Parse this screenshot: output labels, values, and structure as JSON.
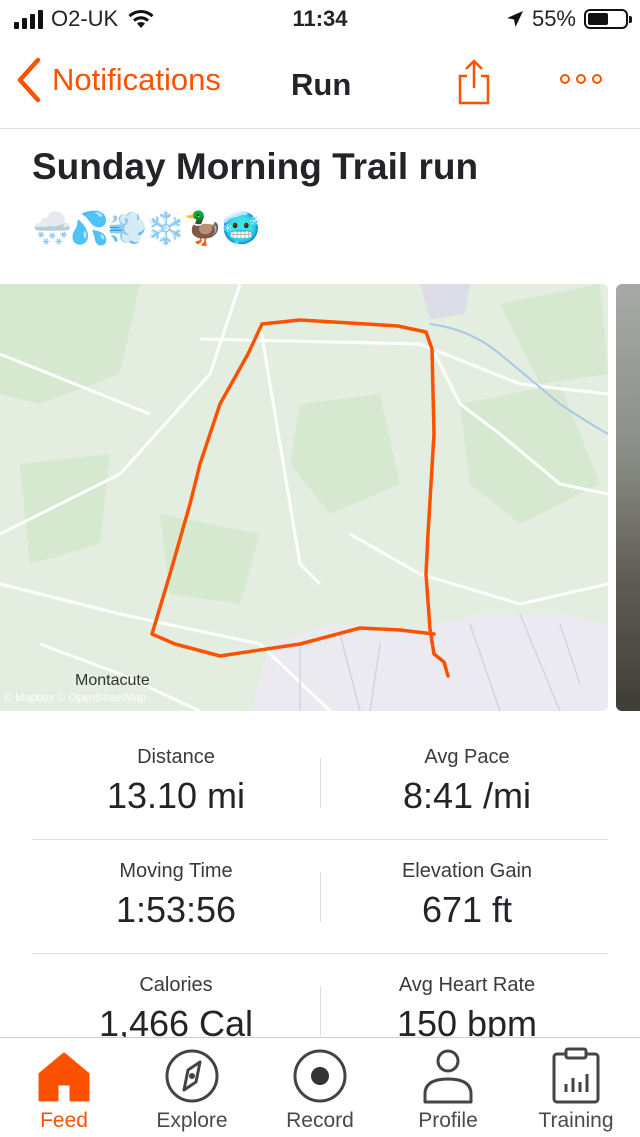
{
  "status_bar": {
    "carrier": "O2-UK",
    "time": "11:34",
    "battery": "55%"
  },
  "nav": {
    "back_label": "Notifications",
    "title": "Run"
  },
  "activity": {
    "title": "Sunday Morning Trail run",
    "emojis": "🌨️💦💨❄️🦆🥶"
  },
  "map": {
    "place_label": "Montacute",
    "attribution": "© Mapbox © OpenStreetMap",
    "route_color": "#fc5200"
  },
  "stats": [
    {
      "left": {
        "label": "Distance",
        "value": "13.10 mi"
      },
      "right": {
        "label": "Avg Pace",
        "value": "8:41 /mi"
      }
    },
    {
      "left": {
        "label": "Moving Time",
        "value": "1:53:56"
      },
      "right": {
        "label": "Elevation Gain",
        "value": "671 ft"
      }
    },
    {
      "left": {
        "label": "Calories",
        "value": "1,466 Cal"
      },
      "right": {
        "label": "Avg Heart Rate",
        "value": "150 bpm"
      }
    }
  ],
  "tabs": [
    {
      "label": "Feed",
      "icon": "home-icon",
      "active": true
    },
    {
      "label": "Explore",
      "icon": "compass-icon"
    },
    {
      "label": "Record",
      "icon": "record-icon"
    },
    {
      "label": "Profile",
      "icon": "profile-icon"
    },
    {
      "label": "Training",
      "icon": "training-icon"
    }
  ],
  "colors": {
    "accent": "#fc5200",
    "text": "#242428"
  }
}
